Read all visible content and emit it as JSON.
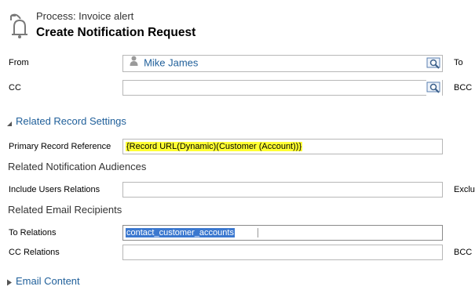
{
  "header": {
    "process_label": "Process: Invoice alert",
    "title": "Create Notification Request"
  },
  "fields": {
    "from": {
      "label": "From",
      "value": "Mike James",
      "right_label": "To"
    },
    "cc": {
      "label": "CC",
      "value": "",
      "right_label": "BCC"
    }
  },
  "related_record_settings": {
    "title": "Related Record Settings",
    "primary_record_reference": {
      "label": "Primary Record Reference",
      "value": "{Record URL(Dynamic)(Customer (Account))}"
    }
  },
  "related_notification_audiences": {
    "title": "Related Notification Audiences",
    "include_users_relations": {
      "label": "Include Users Relations",
      "value": "",
      "right_label": "Exclu"
    }
  },
  "related_email_recipients": {
    "title": "Related Email Recipients",
    "to_relations": {
      "label": "To Relations",
      "value": "contact_customer_accounts"
    },
    "cc_relations": {
      "label": "CC Relations",
      "value": "",
      "right_label": "BCC R"
    }
  },
  "email_content": {
    "title": "Email Content"
  },
  "colors": {
    "link_blue": "#1f5f9a",
    "highlight_yellow": "#ffff33",
    "selection_blue": "#3b78cf",
    "input_border": "#b7b7b7"
  },
  "icons": {
    "header": "bell-process-icon",
    "person": "person-icon",
    "lookup": "lookup-search-icon",
    "expanded": "caret-down-icon",
    "collapsed": "caret-right-icon"
  }
}
